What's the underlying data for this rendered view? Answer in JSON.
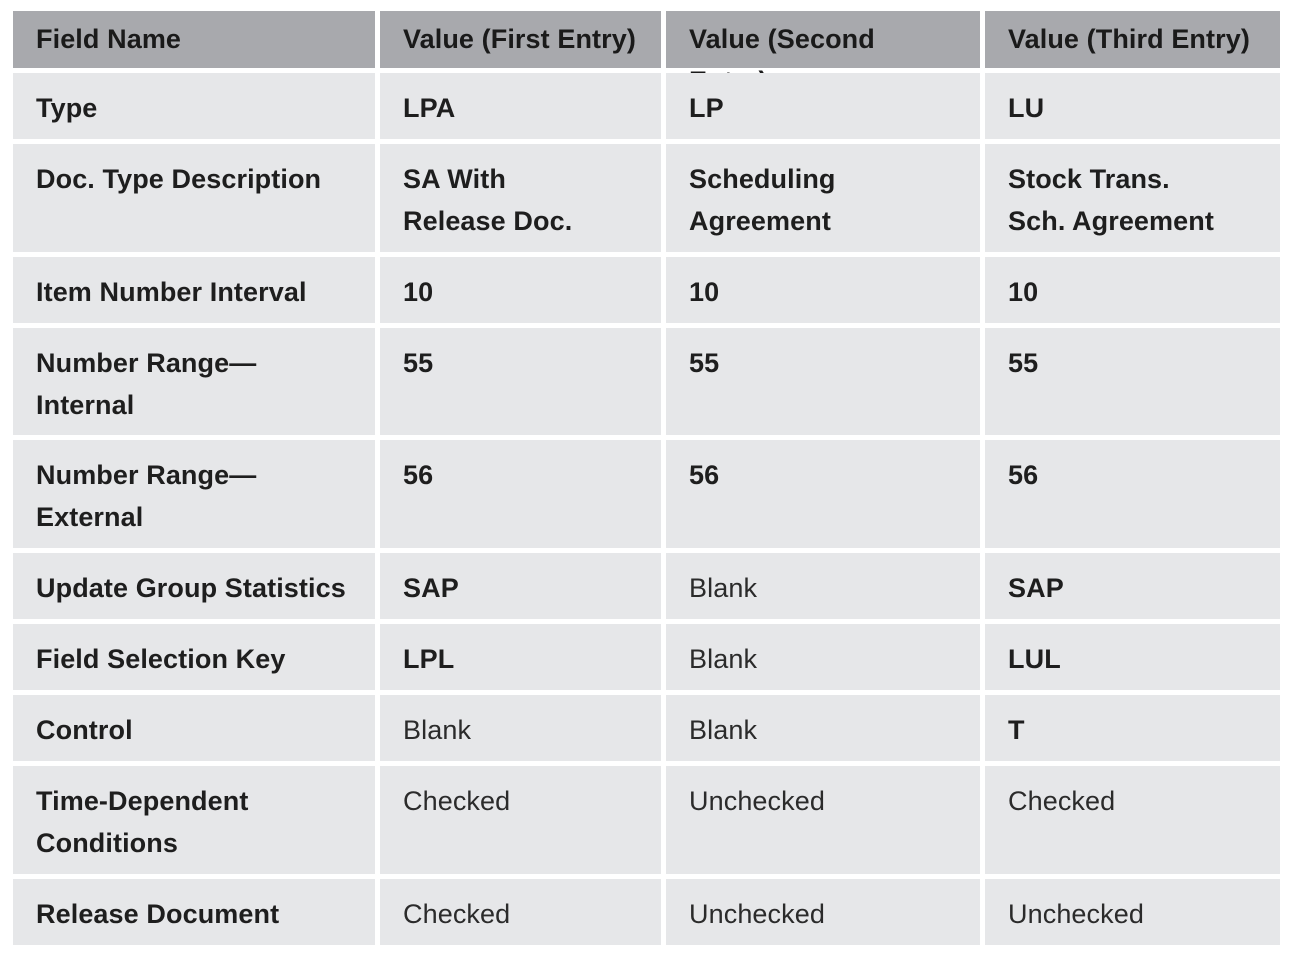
{
  "table": {
    "headers": [
      "Field Name",
      "Value (First Entry)",
      "Value (Second Entry)",
      "Value (Third Entry)"
    ],
    "rows": [
      {
        "field": "Type",
        "values": [
          "LPA",
          "LP",
          "LU"
        ],
        "styles": [
          "code",
          "code",
          "code"
        ]
      },
      {
        "field": "Doc. Type Description",
        "values": [
          "SA With\nRelease Doc.",
          "Scheduling\nAgreement",
          "Stock Trans.\nSch. Agreement"
        ],
        "styles": [
          "code",
          "code",
          "code"
        ]
      },
      {
        "field": "Item Number Interval",
        "values": [
          "10",
          "10",
          "10"
        ],
        "styles": [
          "code",
          "code",
          "code"
        ]
      },
      {
        "field": "Number Range—\nInternal",
        "values": [
          "55",
          "55",
          "55"
        ],
        "styles": [
          "code",
          "code",
          "code"
        ]
      },
      {
        "field": "Number Range—\nExternal",
        "values": [
          "56",
          "56",
          "56"
        ],
        "styles": [
          "code",
          "code",
          "code"
        ]
      },
      {
        "field": "Update Group Statistics",
        "values": [
          "SAP",
          "Blank",
          "SAP"
        ],
        "styles": [
          "code",
          "plain",
          "code"
        ]
      },
      {
        "field": "Field Selection Key",
        "values": [
          "LPL",
          "Blank",
          "LUL"
        ],
        "styles": [
          "code",
          "plain",
          "code"
        ]
      },
      {
        "field": "Control",
        "values": [
          "Blank",
          "Blank",
          "T"
        ],
        "styles": [
          "plain",
          "plain",
          "code"
        ]
      },
      {
        "field": "Time-Dependent\nConditions",
        "values": [
          "Checked",
          "Unchecked",
          "Checked"
        ],
        "styles": [
          "plain",
          "plain",
          "plain"
        ]
      },
      {
        "field": "Release Document",
        "values": [
          "Checked",
          "Unchecked",
          "Unchecked"
        ],
        "styles": [
          "plain",
          "plain",
          "plain"
        ]
      }
    ]
  },
  "colors": {
    "header_bg": "#a8a9ad",
    "cell_bg": "#e6e7e9",
    "gap": "#ffffff"
  }
}
